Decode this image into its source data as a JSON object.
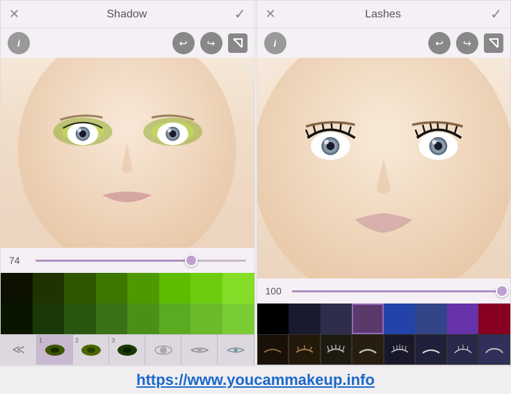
{
  "panels": [
    {
      "id": "shadow",
      "title": "Shadow",
      "slider_value": "74",
      "slider_pct": 74,
      "colors": [
        "#1a1a0a",
        "#2d4a00",
        "#3a6000",
        "#4a7800",
        "#5a9000",
        "#6aaa00",
        "#7cc020",
        "#95d030",
        "#1a2a0a",
        "#2a4a10",
        "#3a6015",
        "#4a7820",
        "#5a9020",
        "#6aaa28",
        "#7ab830",
        "#8ac838"
      ],
      "palette_rows": 2,
      "tabs": [
        {
          "label": "",
          "icon": "double-chevron",
          "badge": ""
        },
        {
          "label": "1",
          "icon": "eye",
          "badge": "1"
        },
        {
          "label": "2",
          "icon": "eye",
          "badge": "2"
        },
        {
          "label": "3",
          "icon": "eye",
          "badge": "3"
        },
        {
          "label": "",
          "icon": "eye-style1",
          "badge": ""
        },
        {
          "label": "",
          "icon": "eye-style2",
          "badge": ""
        },
        {
          "label": "",
          "icon": "eye-style3",
          "badge": ""
        }
      ],
      "active_tab": 2
    },
    {
      "id": "lashes",
      "title": "Lashes",
      "slider_value": "100",
      "slider_pct": 100,
      "color_row": [
        "#000000",
        "#1a1a2e",
        "#2e2e4a",
        "#5a3a6a",
        "#2244aa",
        "#334488",
        "#6633aa",
        "#880022"
      ],
      "style_row": [
        "#2a1a0a",
        "#3a2a1a",
        "#4a3a2a",
        "#5a4a3a",
        "#2a2a3a",
        "#3a3a4a",
        "#4a4a5a",
        "#5a5a6a"
      ],
      "selected_color_idx": 4,
      "selected_style_idx": -1,
      "lash_styles": [
        "🪮",
        "🪮",
        "🪮",
        "🪮",
        "🪮",
        "🪮",
        "🪮",
        "🪮"
      ]
    }
  ],
  "footer": {
    "url": "https://www.youcammakeup.info"
  },
  "icons": {
    "close": "✕",
    "check": "✓",
    "info": "i",
    "undo": "↩",
    "redo": "↪",
    "corner": "⌐"
  }
}
